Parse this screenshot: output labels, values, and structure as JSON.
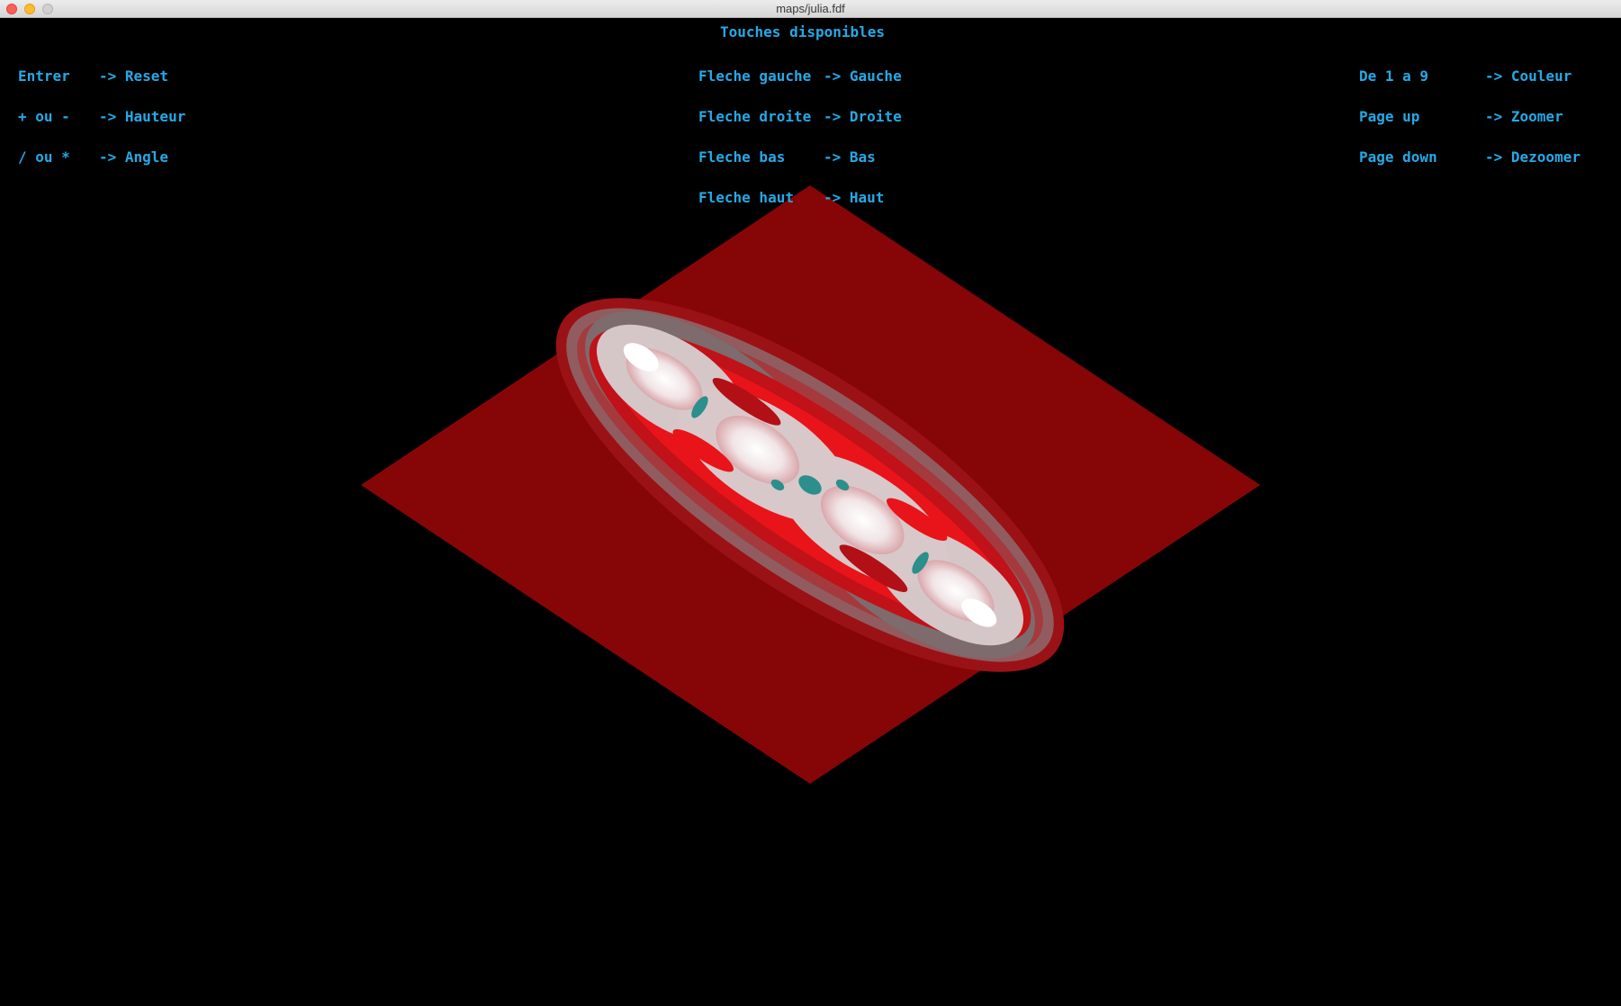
{
  "window": {
    "title": "maps/julia.fdf"
  },
  "help": {
    "heading": "Touches disponibles",
    "left": [
      {
        "key": "Entrer",
        "action": "-> Reset"
      },
      {
        "key": "+ ou -",
        "action": "-> Hauteur"
      },
      {
        "key": "/ ou *",
        "action": "-> Angle"
      }
    ],
    "center": [
      {
        "key": "Fleche gauche",
        "action": "-> Gauche"
      },
      {
        "key": "Fleche droite",
        "action": "-> Droite"
      },
      {
        "key": "Fleche bas",
        "action": "-> Bas"
      },
      {
        "key": "Fleche haut",
        "action": "-> Haut"
      }
    ],
    "right": [
      {
        "key": "De 1 a 9",
        "action": "-> Couleur"
      },
      {
        "key": "Page up",
        "action": "-> Zoomer"
      },
      {
        "key": "Page down",
        "action": "-> Dezoomer"
      }
    ]
  },
  "colors": {
    "text": "#26a9e6",
    "background": "#000000",
    "plane": "#8a0607",
    "fractal_band_red": "#e8141a",
    "fractal_band_grey": "#8c7a7c",
    "fractal_core": "#f2f2f2",
    "fractal_teal": "#2b8f8c"
  }
}
